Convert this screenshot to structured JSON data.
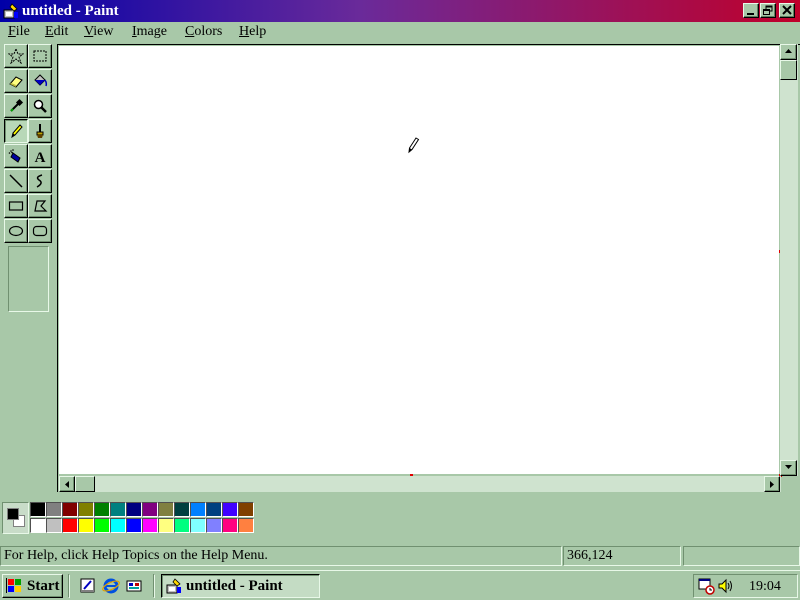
{
  "window": {
    "title": "untitled - Paint"
  },
  "menu": {
    "items": [
      {
        "label": "File",
        "key": "F",
        "rest": "ile"
      },
      {
        "label": "Edit",
        "key": "E",
        "rest": "dit"
      },
      {
        "label": "View",
        "key": "V",
        "rest": "iew"
      },
      {
        "label": "Image",
        "key": "I",
        "rest": "mage"
      },
      {
        "label": "Colors",
        "key": "C",
        "rest": "olors"
      },
      {
        "label": "Help",
        "key": "H",
        "rest": "elp"
      }
    ]
  },
  "toolbox": {
    "tools": [
      {
        "name": "free-form-select",
        "icon": "star-select-icon"
      },
      {
        "name": "select",
        "icon": "rect-select-icon"
      },
      {
        "name": "eraser",
        "icon": "eraser-icon"
      },
      {
        "name": "fill-with-color",
        "icon": "paint-bucket-icon"
      },
      {
        "name": "pick-color",
        "icon": "eyedropper-icon"
      },
      {
        "name": "magnifier",
        "icon": "magnifier-icon"
      },
      {
        "name": "pencil",
        "icon": "pencil-icon",
        "selected": true
      },
      {
        "name": "brush",
        "icon": "brush-icon"
      },
      {
        "name": "airbrush",
        "icon": "airbrush-icon"
      },
      {
        "name": "text",
        "icon": "text-icon",
        "glyph": "A"
      },
      {
        "name": "line",
        "icon": "line-icon"
      },
      {
        "name": "curve",
        "icon": "curve-icon"
      },
      {
        "name": "rectangle",
        "icon": "rectangle-icon"
      },
      {
        "name": "polygon",
        "icon": "polygon-icon"
      },
      {
        "name": "ellipse",
        "icon": "ellipse-icon"
      },
      {
        "name": "rounded-rectangle",
        "icon": "rounded-rectangle-icon"
      }
    ]
  },
  "palette": {
    "foreground": "#000000",
    "background": "#ffffff",
    "row1": [
      "#000000",
      "#808080",
      "#800000",
      "#808000",
      "#008000",
      "#008080",
      "#000080",
      "#800080",
      "#808040",
      "#004040",
      "#0080ff",
      "#004080",
      "#4000ff",
      "#804000"
    ],
    "row2": [
      "#ffffff",
      "#c0c0c0",
      "#ff0000",
      "#ffff00",
      "#00ff00",
      "#00ffff",
      "#0000ff",
      "#ff00ff",
      "#ffff80",
      "#00ff80",
      "#80ffff",
      "#8080ff",
      "#ff0080",
      "#ff8040"
    ]
  },
  "status": {
    "help_text": "For Help, click Help Topics on the Help Menu.",
    "coordinates": "366,124",
    "size": ""
  },
  "taskbar": {
    "start_label": "Start",
    "task_label": "untitled - Paint",
    "clock": "19:04",
    "quick_launch": [
      "quick-launch-desktop-icon",
      "internet-explorer-icon",
      "channels-icon"
    ]
  }
}
